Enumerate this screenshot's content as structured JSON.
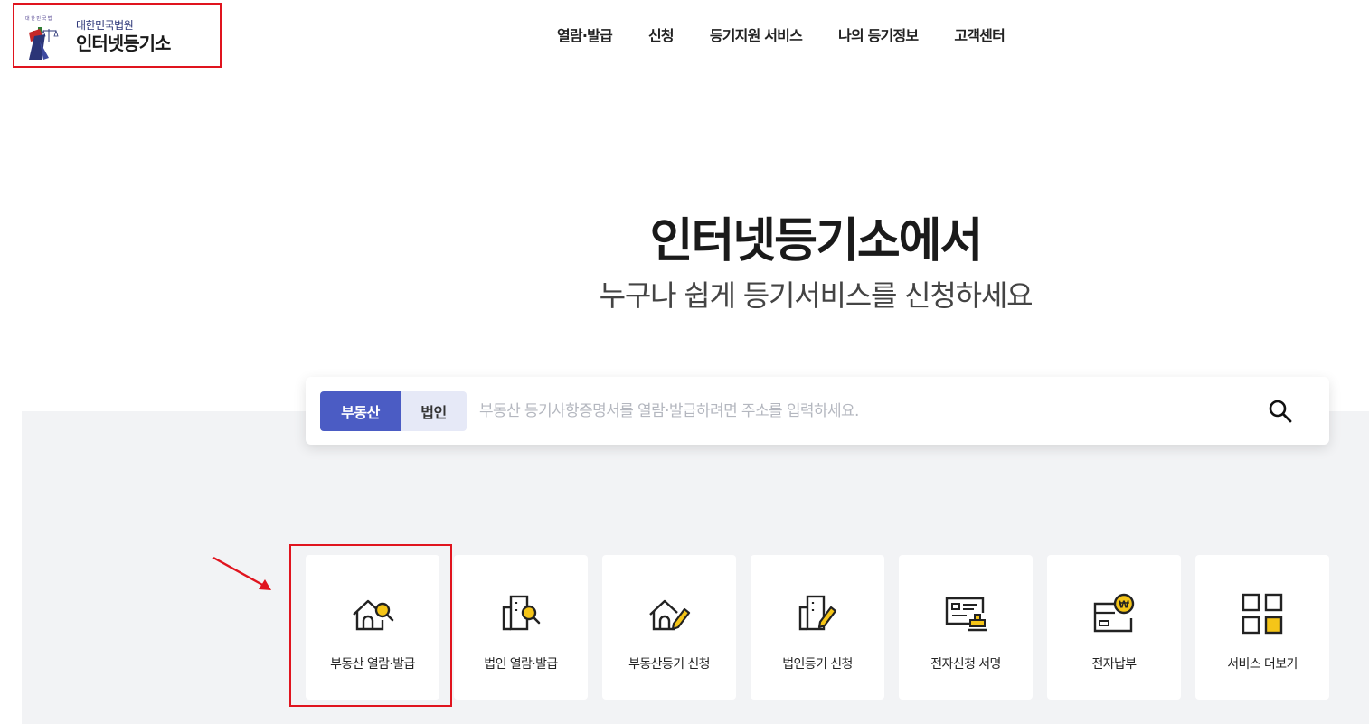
{
  "header": {
    "logo": {
      "subtitle": "대한민국법원",
      "title": "인터넷등기소"
    },
    "nav": [
      {
        "label": "열람·발급"
      },
      {
        "label": "신청"
      },
      {
        "label": "등기지원 서비스"
      },
      {
        "label": "나의 등기정보"
      },
      {
        "label": "고객센터"
      }
    ]
  },
  "hero": {
    "title": "인터넷등기소에서",
    "subtitle": "누구나 쉽게 등기서비스를 신청하세요"
  },
  "search": {
    "tabs": [
      {
        "label": "부동산",
        "selected": true
      },
      {
        "label": "법인",
        "selected": false
      }
    ],
    "placeholder": "부동산 등기사항증명서를 열람·발급하려면 주소를 입력하세요.",
    "value": "",
    "button_icon": "search-icon"
  },
  "services": [
    {
      "label": "부동산 열람·발급",
      "icon": "house-search-icon",
      "highlighted": true
    },
    {
      "label": "법인 열람·발급",
      "icon": "building-search-icon"
    },
    {
      "label": "부동산등기 신청",
      "icon": "house-pencil-icon"
    },
    {
      "label": "법인등기 신청",
      "icon": "building-pencil-icon"
    },
    {
      "label": "전자신청 서명",
      "icon": "document-stamp-icon"
    },
    {
      "label": "전자납부",
      "icon": "wallet-won-icon"
    },
    {
      "label": "서비스 더보기",
      "icon": "grid-more-icon"
    }
  ],
  "colors": {
    "accent": "#4b5cc4",
    "accent_light": "#e6e9f7",
    "icon_yellow": "#f5c518",
    "band_bg": "#f2f3f5",
    "annotation_red": "#e0141e"
  }
}
